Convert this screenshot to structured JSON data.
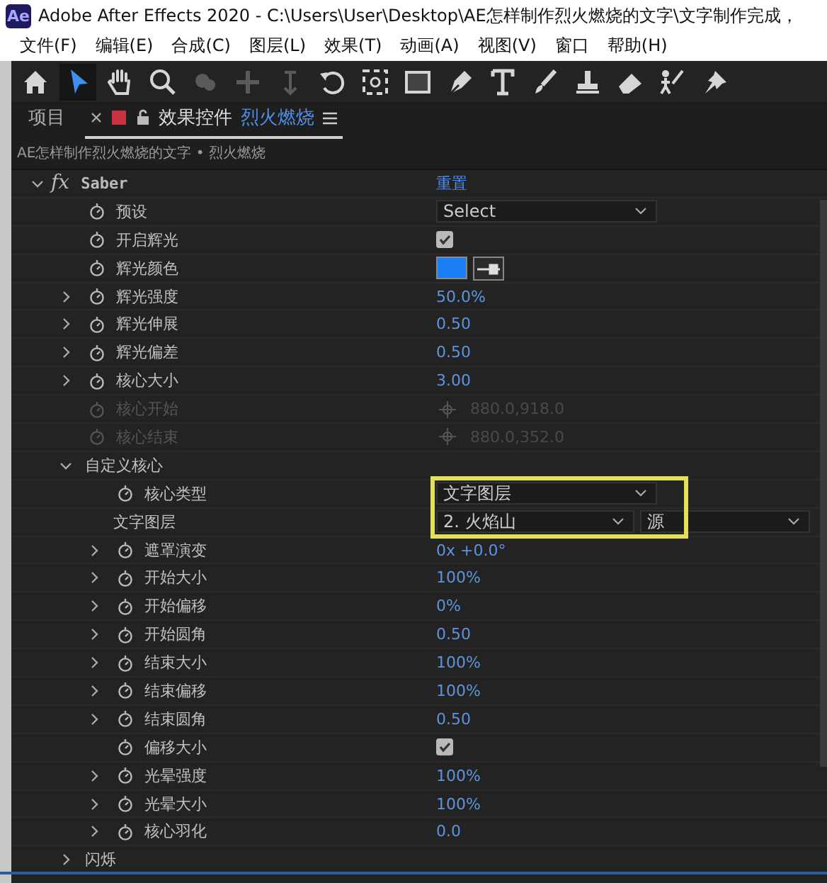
{
  "window": {
    "app_icon": "Ae",
    "title": "Adobe After Effects 2020 - C:\\Users\\User\\Desktop\\AE怎样制作烈火燃烧的文字\\文字制作完成，"
  },
  "menu": [
    "文件(F)",
    "编辑(E)",
    "合成(C)",
    "图层(L)",
    "效果(T)",
    "动画(A)",
    "视图(V)",
    "窗口",
    "帮助(H)"
  ],
  "toolbar": [
    {
      "kind": "home",
      "selected": false,
      "disabled": false
    },
    {
      "kind": "arrow",
      "selected": true,
      "disabled": false
    },
    {
      "kind": "hand",
      "selected": false,
      "disabled": false
    },
    {
      "kind": "zoom",
      "selected": false,
      "disabled": false
    },
    {
      "kind": "orbit",
      "selected": false,
      "disabled": true
    },
    {
      "kind": "pan",
      "selected": false,
      "disabled": true
    },
    {
      "kind": "dolly",
      "selected": false,
      "disabled": true
    },
    {
      "kind": "rotate",
      "selected": false,
      "disabled": false
    },
    {
      "kind": "anchor",
      "selected": false,
      "disabled": false
    },
    {
      "kind": "rect",
      "selected": false,
      "disabled": false
    },
    {
      "kind": "pen",
      "selected": false,
      "disabled": false
    },
    {
      "kind": "type",
      "selected": false,
      "disabled": false
    },
    {
      "kind": "brush",
      "selected": false,
      "disabled": false
    },
    {
      "kind": "stamp",
      "selected": false,
      "disabled": false
    },
    {
      "kind": "eraser",
      "selected": false,
      "disabled": false
    },
    {
      "kind": "roto",
      "selected": false,
      "disabled": false
    },
    {
      "kind": "pin",
      "selected": false,
      "disabled": false
    }
  ],
  "panel_tabs": [
    {
      "label": "项目",
      "selected": false
    },
    {
      "label": "效果控件",
      "layer": "烈火燃烧",
      "selected": true
    }
  ],
  "breadcrumb": "AE怎样制作烈火燃烧的文字 • 烈火燃烧",
  "effects": [
    {
      "icon_text": "fx",
      "name": "Saber",
      "expanded": true,
      "reset": "重置",
      "children": [
        {
          "label": "预设",
          "animatable": true,
          "value": {
            "kind": "dropdown",
            "text": "Select"
          }
        },
        {
          "label": "开启辉光",
          "animatable": true,
          "value": {
            "kind": "checkbox",
            "checked": true
          }
        },
        {
          "label": "辉光颜色",
          "animatable": true,
          "value": {
            "kind": "color",
            "color": "#1a7ff5"
          }
        },
        {
          "label": "辉光强度",
          "animatable": true,
          "expanded": false,
          "value": {
            "kind": "number",
            "text": "50.0%"
          }
        },
        {
          "label": "辉光伸展",
          "animatable": true,
          "expanded": false,
          "value": {
            "kind": "number",
            "text": "0.50"
          }
        },
        {
          "label": "辉光偏差",
          "animatable": true,
          "expanded": false,
          "value": {
            "kind": "number",
            "text": "0.50"
          }
        },
        {
          "label": "核心大小",
          "animatable": true,
          "expanded": false,
          "value": {
            "kind": "number",
            "text": "3.00"
          }
        },
        {
          "label": "核心开始",
          "animatable": true,
          "disabled": true,
          "value": {
            "kind": "point",
            "text": "880.0,918.0"
          }
        },
        {
          "label": "核心结束",
          "animatable": true,
          "disabled": true,
          "value": {
            "kind": "point",
            "text": "880.0,352.0"
          }
        },
        {
          "label": "自定义核心",
          "expanded": true,
          "children": [
            {
              "label": "核心类型",
              "animatable": true,
              "highlighted": true,
              "value": {
                "kind": "dropdown",
                "text": "文字图层"
              }
            },
            {
              "label": "文字图层",
              "animatable": false,
              "highlighted": true,
              "value": {
                "kind": "layer",
                "layer": "2. 火焰山",
                "source": "源"
              }
            },
            {
              "label": "遮罩演变",
              "animatable": true,
              "expanded": false,
              "value": {
                "kind": "number",
                "text": "0x +0.0°"
              }
            },
            {
              "label": "开始大小",
              "animatable": true,
              "expanded": false,
              "value": {
                "kind": "number",
                "text": "100%"
              }
            },
            {
              "label": "开始偏移",
              "animatable": true,
              "expanded": false,
              "value": {
                "kind": "number",
                "text": "0%"
              }
            },
            {
              "label": "开始圆角",
              "animatable": true,
              "expanded": false,
              "value": {
                "kind": "number",
                "text": "0.50"
              }
            },
            {
              "label": "结束大小",
              "animatable": true,
              "expanded": false,
              "value": {
                "kind": "number",
                "text": "100%"
              }
            },
            {
              "label": "结束偏移",
              "animatable": true,
              "expanded": false,
              "value": {
                "kind": "number",
                "text": "100%"
              }
            },
            {
              "label": "结束圆角",
              "animatable": true,
              "expanded": false,
              "value": {
                "kind": "number",
                "text": "0.50"
              }
            },
            {
              "label": "偏移大小",
              "animatable": true,
              "value": {
                "kind": "checkbox",
                "checked": true
              }
            },
            {
              "label": "光晕强度",
              "animatable": true,
              "expanded": false,
              "value": {
                "kind": "number",
                "text": "100%"
              }
            },
            {
              "label": "光晕大小",
              "animatable": true,
              "expanded": false,
              "value": {
                "kind": "number",
                "text": "100%"
              }
            },
            {
              "label": "核心羽化",
              "animatable": true,
              "expanded": false,
              "value": {
                "kind": "number",
                "text": "0.0"
              }
            }
          ]
        },
        {
          "label": "闪烁",
          "expanded": false
        }
      ]
    }
  ]
}
